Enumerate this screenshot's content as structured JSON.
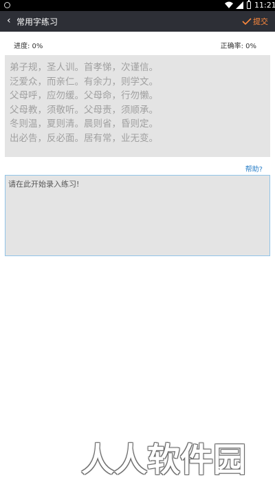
{
  "status_bar": {
    "time": "11:21"
  },
  "header": {
    "back_icon": "chevron-left-icon",
    "title": "常用字练习",
    "submit_label": "提交",
    "submit_icon": "checkmark-icon",
    "accent_color": "#ff8a3d"
  },
  "stats": {
    "progress": "进度: 0%",
    "accuracy": "正确率: 0%"
  },
  "practice_text": [
    "弟子规，圣人训。首孝悌，次谨信。",
    "泛爱众，而亲仁。有余力，则学文。",
    "父母呼，应勿缓。父母命，行勿懒。",
    "父母教，须敬听。父母责，须顺承。",
    "冬则温，夏则清。晨则省，昏则定。",
    "出必告，反必面。居有常，业无变。"
  ],
  "help_label": "帮助?",
  "input": {
    "placeholder": "请在此开始录入练习!"
  },
  "watermark": "人人软件园"
}
